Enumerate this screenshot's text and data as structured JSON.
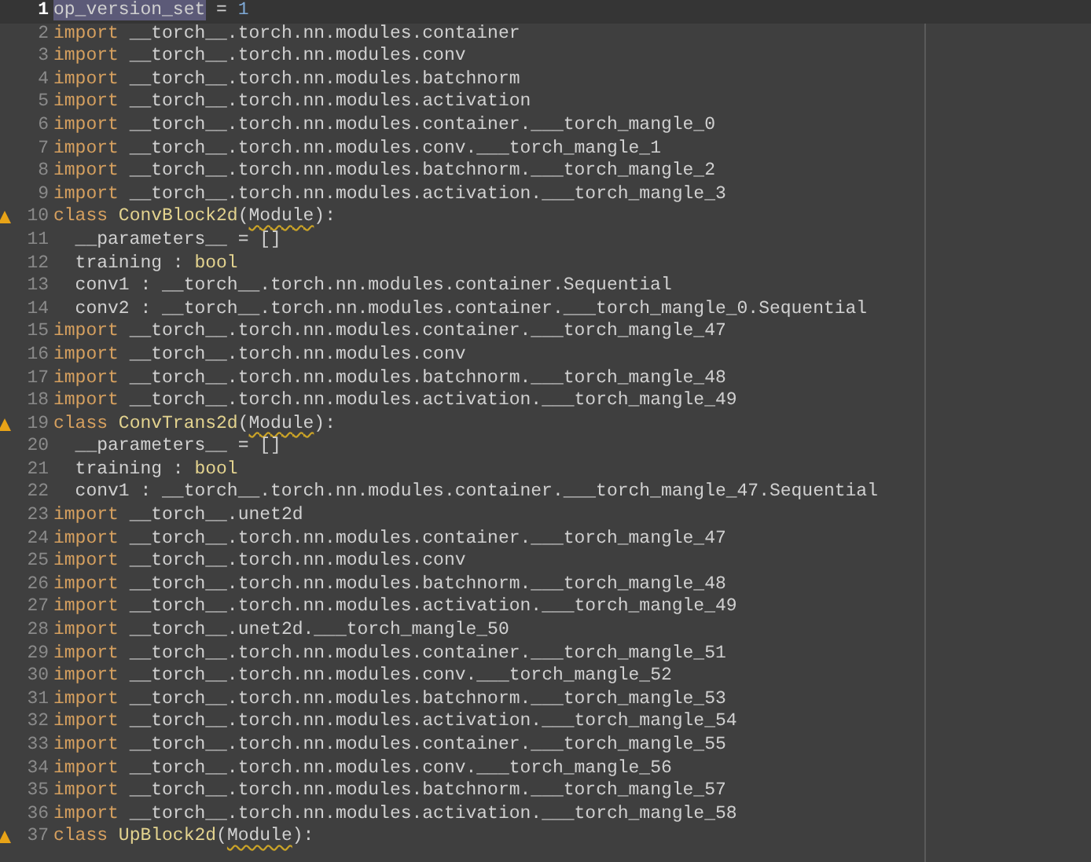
{
  "editor": {
    "lines": [
      {
        "number": "1",
        "current": true,
        "warning": false,
        "tokens": [
          {
            "kind": "selected",
            "text": "op_version_set"
          },
          {
            "kind": "plain",
            "text": " = "
          },
          {
            "kind": "number",
            "text": "1"
          }
        ]
      },
      {
        "number": "2",
        "current": false,
        "warning": false,
        "tokens": [
          {
            "kind": "keyword",
            "text": "import"
          },
          {
            "kind": "plain",
            "text": " __torch__.torch.nn.modules.container"
          }
        ]
      },
      {
        "number": "3",
        "current": false,
        "warning": false,
        "tokens": [
          {
            "kind": "keyword",
            "text": "import"
          },
          {
            "kind": "plain",
            "text": " __torch__.torch.nn.modules.conv"
          }
        ]
      },
      {
        "number": "4",
        "current": false,
        "warning": false,
        "tokens": [
          {
            "kind": "keyword",
            "text": "import"
          },
          {
            "kind": "plain",
            "text": " __torch__.torch.nn.modules.batchnorm"
          }
        ]
      },
      {
        "number": "5",
        "current": false,
        "warning": false,
        "tokens": [
          {
            "kind": "keyword",
            "text": "import"
          },
          {
            "kind": "plain",
            "text": " __torch__.torch.nn.modules.activation"
          }
        ]
      },
      {
        "number": "6",
        "current": false,
        "warning": false,
        "tokens": [
          {
            "kind": "keyword",
            "text": "import"
          },
          {
            "kind": "plain",
            "text": " __torch__.torch.nn.modules.container.___torch_mangle_0"
          }
        ]
      },
      {
        "number": "7",
        "current": false,
        "warning": false,
        "tokens": [
          {
            "kind": "keyword",
            "text": "import"
          },
          {
            "kind": "plain",
            "text": " __torch__.torch.nn.modules.conv.___torch_mangle_1"
          }
        ]
      },
      {
        "number": "8",
        "current": false,
        "warning": false,
        "tokens": [
          {
            "kind": "keyword",
            "text": "import"
          },
          {
            "kind": "plain",
            "text": " __torch__.torch.nn.modules.batchnorm.___torch_mangle_2"
          }
        ]
      },
      {
        "number": "9",
        "current": false,
        "warning": false,
        "tokens": [
          {
            "kind": "keyword",
            "text": "import"
          },
          {
            "kind": "plain",
            "text": " __torch__.torch.nn.modules.activation.___torch_mangle_3"
          }
        ]
      },
      {
        "number": "10",
        "current": false,
        "warning": true,
        "tokens": [
          {
            "kind": "keyword",
            "text": "class "
          },
          {
            "kind": "classname",
            "text": "ConvBlock2d"
          },
          {
            "kind": "plain",
            "text": "("
          },
          {
            "kind": "squiggle",
            "text": "Module"
          },
          {
            "kind": "plain",
            "text": "):"
          }
        ]
      },
      {
        "number": "11",
        "current": false,
        "warning": false,
        "tokens": [
          {
            "kind": "plain",
            "text": "  __parameters__ = []"
          }
        ]
      },
      {
        "number": "12",
        "current": false,
        "warning": false,
        "tokens": [
          {
            "kind": "plain",
            "text": "  training : "
          },
          {
            "kind": "builtin",
            "text": "bool"
          }
        ]
      },
      {
        "number": "13",
        "current": false,
        "warning": false,
        "tokens": [
          {
            "kind": "plain",
            "text": "  conv1 : __torch__.torch.nn.modules.container.Sequential"
          }
        ]
      },
      {
        "number": "14",
        "current": false,
        "warning": false,
        "tokens": [
          {
            "kind": "plain",
            "text": "  conv2 : __torch__.torch.nn.modules.container.___torch_mangle_0.Sequential"
          }
        ]
      },
      {
        "number": "15",
        "current": false,
        "warning": false,
        "tokens": [
          {
            "kind": "keyword",
            "text": "import"
          },
          {
            "kind": "plain",
            "text": " __torch__.torch.nn.modules.container.___torch_mangle_47"
          }
        ]
      },
      {
        "number": "16",
        "current": false,
        "warning": false,
        "tokens": [
          {
            "kind": "keyword",
            "text": "import"
          },
          {
            "kind": "plain",
            "text": " __torch__.torch.nn.modules.conv"
          }
        ]
      },
      {
        "number": "17",
        "current": false,
        "warning": false,
        "tokens": [
          {
            "kind": "keyword",
            "text": "import"
          },
          {
            "kind": "plain",
            "text": " __torch__.torch.nn.modules.batchnorm.___torch_mangle_48"
          }
        ]
      },
      {
        "number": "18",
        "current": false,
        "warning": false,
        "tokens": [
          {
            "kind": "keyword",
            "text": "import"
          },
          {
            "kind": "plain",
            "text": " __torch__.torch.nn.modules.activation.___torch_mangle_49"
          }
        ]
      },
      {
        "number": "19",
        "current": false,
        "warning": true,
        "tokens": [
          {
            "kind": "keyword",
            "text": "class "
          },
          {
            "kind": "classname",
            "text": "ConvTrans2d"
          },
          {
            "kind": "plain",
            "text": "("
          },
          {
            "kind": "squiggle",
            "text": "Module"
          },
          {
            "kind": "plain",
            "text": "):"
          }
        ]
      },
      {
        "number": "20",
        "current": false,
        "warning": false,
        "tokens": [
          {
            "kind": "plain",
            "text": "  __parameters__ = []"
          }
        ]
      },
      {
        "number": "21",
        "current": false,
        "warning": false,
        "tokens": [
          {
            "kind": "plain",
            "text": "  training : "
          },
          {
            "kind": "builtin",
            "text": "bool"
          }
        ]
      },
      {
        "number": "22",
        "current": false,
        "warning": false,
        "tokens": [
          {
            "kind": "plain",
            "text": "  conv1 : __torch__.torch.nn.modules.container.___torch_mangle_47.Sequential"
          }
        ]
      },
      {
        "number": "23",
        "current": false,
        "warning": false,
        "tokens": [
          {
            "kind": "keyword",
            "text": "import"
          },
          {
            "kind": "plain",
            "text": " __torch__.unet2d"
          }
        ]
      },
      {
        "number": "24",
        "current": false,
        "warning": false,
        "tokens": [
          {
            "kind": "keyword",
            "text": "import"
          },
          {
            "kind": "plain",
            "text": " __torch__.torch.nn.modules.container.___torch_mangle_47"
          }
        ]
      },
      {
        "number": "25",
        "current": false,
        "warning": false,
        "tokens": [
          {
            "kind": "keyword",
            "text": "import"
          },
          {
            "kind": "plain",
            "text": " __torch__.torch.nn.modules.conv"
          }
        ]
      },
      {
        "number": "26",
        "current": false,
        "warning": false,
        "tokens": [
          {
            "kind": "keyword",
            "text": "import"
          },
          {
            "kind": "plain",
            "text": " __torch__.torch.nn.modules.batchnorm.___torch_mangle_48"
          }
        ]
      },
      {
        "number": "27",
        "current": false,
        "warning": false,
        "tokens": [
          {
            "kind": "keyword",
            "text": "import"
          },
          {
            "kind": "plain",
            "text": " __torch__.torch.nn.modules.activation.___torch_mangle_49"
          }
        ]
      },
      {
        "number": "28",
        "current": false,
        "warning": false,
        "tokens": [
          {
            "kind": "keyword",
            "text": "import"
          },
          {
            "kind": "plain",
            "text": " __torch__.unet2d.___torch_mangle_50"
          }
        ]
      },
      {
        "number": "29",
        "current": false,
        "warning": false,
        "tokens": [
          {
            "kind": "keyword",
            "text": "import"
          },
          {
            "kind": "plain",
            "text": " __torch__.torch.nn.modules.container.___torch_mangle_51"
          }
        ]
      },
      {
        "number": "30",
        "current": false,
        "warning": false,
        "tokens": [
          {
            "kind": "keyword",
            "text": "import"
          },
          {
            "kind": "plain",
            "text": " __torch__.torch.nn.modules.conv.___torch_mangle_52"
          }
        ]
      },
      {
        "number": "31",
        "current": false,
        "warning": false,
        "tokens": [
          {
            "kind": "keyword",
            "text": "import"
          },
          {
            "kind": "plain",
            "text": " __torch__.torch.nn.modules.batchnorm.___torch_mangle_53"
          }
        ]
      },
      {
        "number": "32",
        "current": false,
        "warning": false,
        "tokens": [
          {
            "kind": "keyword",
            "text": "import"
          },
          {
            "kind": "plain",
            "text": " __torch__.torch.nn.modules.activation.___torch_mangle_54"
          }
        ]
      },
      {
        "number": "33",
        "current": false,
        "warning": false,
        "tokens": [
          {
            "kind": "keyword",
            "text": "import"
          },
          {
            "kind": "plain",
            "text": " __torch__.torch.nn.modules.container.___torch_mangle_55"
          }
        ]
      },
      {
        "number": "34",
        "current": false,
        "warning": false,
        "tokens": [
          {
            "kind": "keyword",
            "text": "import"
          },
          {
            "kind": "plain",
            "text": " __torch__.torch.nn.modules.conv.___torch_mangle_56"
          }
        ]
      },
      {
        "number": "35",
        "current": false,
        "warning": false,
        "tokens": [
          {
            "kind": "keyword",
            "text": "import"
          },
          {
            "kind": "plain",
            "text": " __torch__.torch.nn.modules.batchnorm.___torch_mangle_57"
          }
        ]
      },
      {
        "number": "36",
        "current": false,
        "warning": false,
        "tokens": [
          {
            "kind": "keyword",
            "text": "import"
          },
          {
            "kind": "plain",
            "text": " __torch__.torch.nn.modules.activation.___torch_mangle_58"
          }
        ]
      },
      {
        "number": "37",
        "current": false,
        "warning": true,
        "tokens": [
          {
            "kind": "keyword",
            "text": "class "
          },
          {
            "kind": "classname",
            "text": "UpBlock2d"
          },
          {
            "kind": "plain",
            "text": "("
          },
          {
            "kind": "squiggle",
            "text": "Module"
          },
          {
            "kind": "plain",
            "text": "):"
          }
        ]
      }
    ]
  }
}
